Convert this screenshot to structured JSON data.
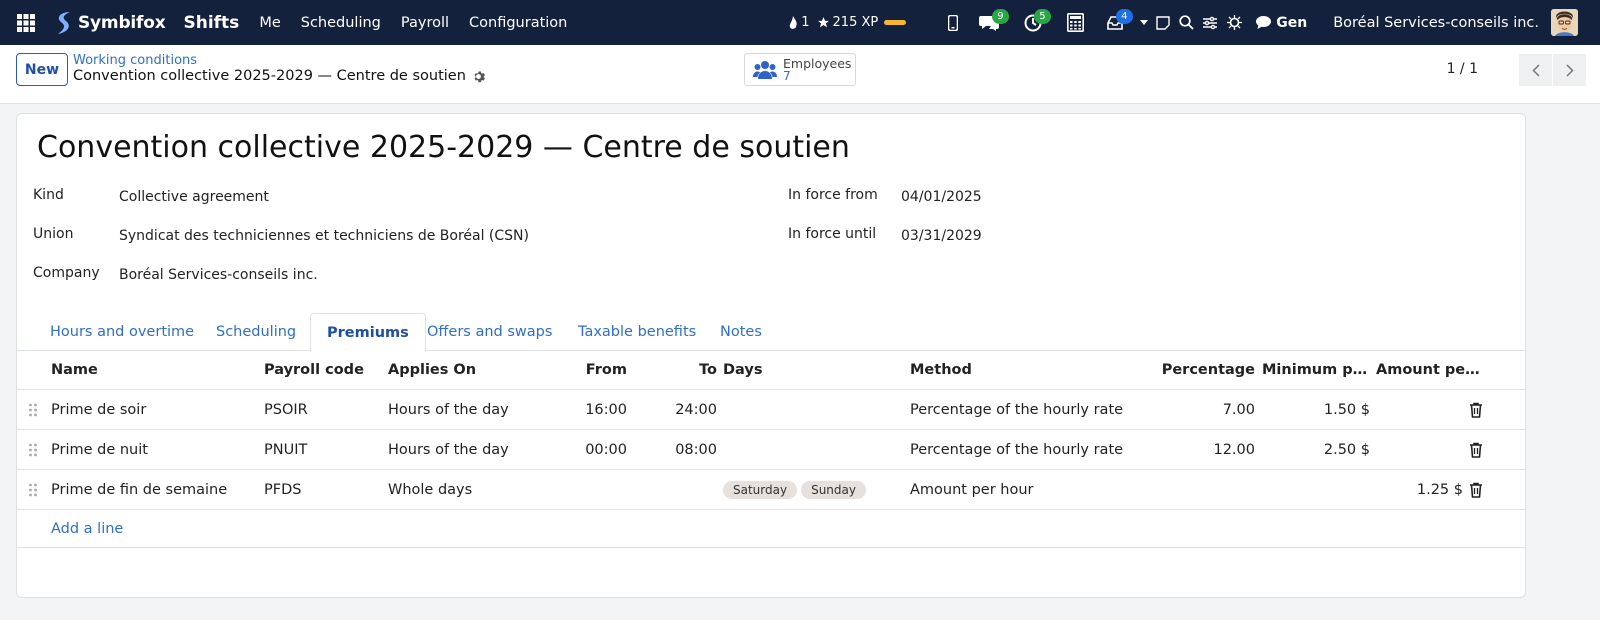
{
  "navbar": {
    "brand": "Symbifox",
    "app_name": "Shifts",
    "menu": [
      "Me",
      "Scheduling",
      "Payroll",
      "Configuration"
    ],
    "xp_count": "1",
    "xp_points": "215 XP",
    "badges": {
      "messages": "9",
      "activities": "5",
      "notifications": "4"
    },
    "gen_label": "Gen",
    "company": "Boréal Services-conseils inc."
  },
  "control": {
    "new_label": "New",
    "breadcrumb": "Working conditions",
    "record_title": "Convention collective 2025-2029 — Centre de soutien",
    "smart_button": {
      "label": "Employees",
      "value": "7"
    },
    "pager": "1 / 1"
  },
  "form": {
    "title": "Convention collective 2025-2029 — Centre de soutien",
    "fields": {
      "kind": {
        "label": "Kind",
        "value": "Collective agreement"
      },
      "union": {
        "label": "Union",
        "value": "Syndicat des techniciennes et techniciens de Boréal (CSN)"
      },
      "company": {
        "label": "Company",
        "value": "Boréal Services-conseils inc."
      },
      "in_force_from": {
        "label": "In force from",
        "value": "04/01/2025"
      },
      "in_force_until": {
        "label": "In force until",
        "value": "03/31/2029"
      }
    },
    "tabs": [
      "Hours and overtime",
      "Scheduling",
      "Premiums",
      "Offers and swaps",
      "Taxable benefits",
      "Notes"
    ],
    "active_tab": "Premiums"
  },
  "premiums": {
    "columns": [
      "Name",
      "Payroll code",
      "Applies On",
      "From",
      "To",
      "Days",
      "Method",
      "Percentage",
      "Minimum per...",
      "Amount per ..."
    ],
    "rows": [
      {
        "name": "Prime de soir",
        "code": "PSOIR",
        "applies_on": "Hours of the day",
        "from": "16:00",
        "to": "24:00",
        "days": [],
        "method": "Percentage of the hourly rate",
        "percentage": "7.00",
        "minimum": "1.50 $",
        "amount": ""
      },
      {
        "name": "Prime de nuit",
        "code": "PNUIT",
        "applies_on": "Hours of the day",
        "from": "00:00",
        "to": "08:00",
        "days": [],
        "method": "Percentage of the hourly rate",
        "percentage": "12.00",
        "minimum": "2.50 $",
        "amount": ""
      },
      {
        "name": "Prime de fin de semaine",
        "code": "PFDS",
        "applies_on": "Whole days",
        "from": "",
        "to": "",
        "days": [
          "Saturday",
          "Sunday"
        ],
        "method": "Amount per hour",
        "percentage": "",
        "minimum": "",
        "amount": "1.25 $"
      }
    ],
    "add_line": "Add a line"
  },
  "colors": {
    "navbar": "#14213d",
    "accent": "#2f6fc7",
    "primary": "#1f4ea8"
  },
  "icons": [
    "apps-grid-icon",
    "fox-logo-icon",
    "flame-icon",
    "star-icon",
    "phone-icon",
    "chat-icon",
    "activity-clock-icon",
    "calculator-icon",
    "inbox-icon",
    "caret-down-icon",
    "note-icon",
    "search-icon",
    "sliders-icon",
    "bug-icon",
    "speech-bubble-icon",
    "gear-icon",
    "users-icon",
    "chevron-left-icon",
    "chevron-right-icon",
    "drag-handle-icon",
    "trash-icon"
  ]
}
